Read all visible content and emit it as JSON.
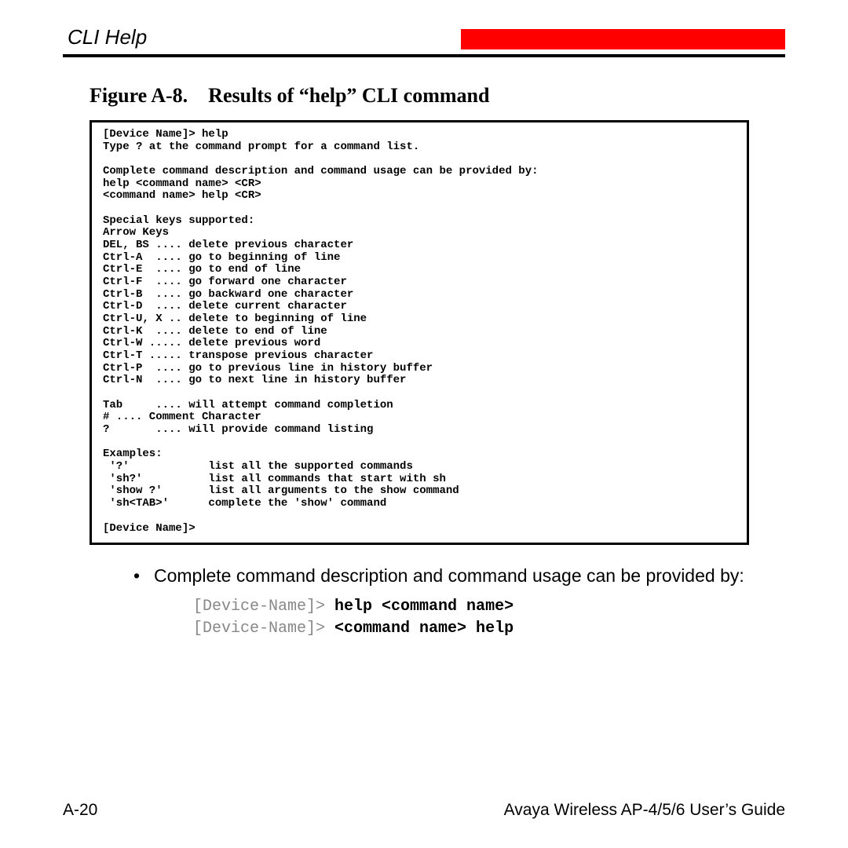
{
  "header": {
    "title": "CLI Help"
  },
  "figure": {
    "caption": "Figure A-8. Results of “help” CLI command"
  },
  "cli": {
    "text": "[Device Name]> help\nType ? at the command prompt for a command list.\n\nComplete command description and command usage can be provided by:\nhelp <command name> <CR>\n<command name> help <CR>\n\nSpecial keys supported:\nArrow Keys\nDEL, BS .... delete previous character\nCtrl-A  .... go to beginning of line\nCtrl-E  .... go to end of line\nCtrl-F  .... go forward one character\nCtrl-B  .... go backward one character\nCtrl-D  .... delete current character\nCtrl-U, X .. delete to beginning of line\nCtrl-K  .... delete to end of line\nCtrl-W ..... delete previous word\nCtrl-T ..... transpose previous character\nCtrl-P  .... go to previous line in history buffer\nCtrl-N  .... go to next line in history buffer\n\nTab     .... will attempt command completion\n# .... Comment Character\n?       .... will provide command listing\n\nExamples:\n '?'            list all the supported commands\n 'sh?'          list all commands that start with sh\n 'show ?'       list all arguments to the show command\n 'sh<TAB>'      complete the 'show' command\n\n[Device Name]>"
  },
  "bullet": {
    "text": "Complete command description and command usage can be provided by:"
  },
  "cmd": {
    "line1_prompt": "[Device-Name]> ",
    "line1_bold": "help <command name>",
    "line2_prompt": "[Device-Name]> ",
    "line2_bold": "<command name> help"
  },
  "footer": {
    "pagenum": "A-20",
    "guide": "Avaya Wireless AP-4/5/6 User’s Guide"
  }
}
